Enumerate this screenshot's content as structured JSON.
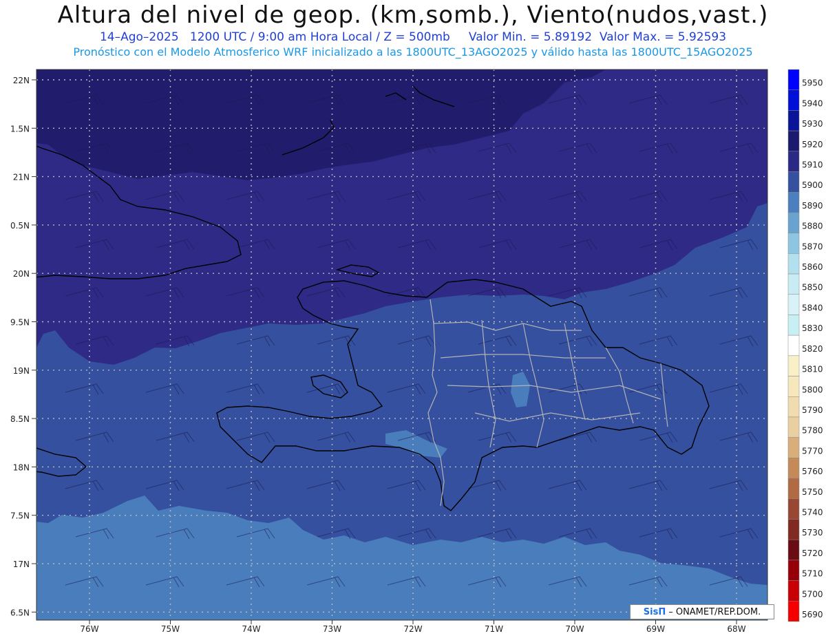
{
  "title": "Altura del nivel de geop. (km,somb.), Viento(nudos,vast.)",
  "subtitle_line1": {
    "date_time": "14–Ago–2025   1200 UTC / 9:00 am Hora Local / Z = 500mb",
    "min_label": "Valor Min. = 5.89192",
    "max_label": "Valor Max. = 5.92593"
  },
  "subtitle_line2": "Pronóstico con el Modelo Atmosferico WRF inicializado a las 1800UTC_13AGO2025 y válido hasta las  1800UTC_15AGO2025",
  "credit": {
    "logo": "SisΠ",
    "text": "– ONAMET/REP.DOM."
  },
  "map_data": {
    "lat_labels": [
      "22N",
      "1.5N",
      "21N",
      "0.5N",
      "20N",
      "9.5N",
      "19N",
      "8.5N",
      "18N",
      "7.5N",
      "17N",
      "6.5N"
    ],
    "lon_labels": [
      "76W",
      "75W",
      "74W",
      "73W",
      "72W",
      "71W",
      "70W",
      "69W",
      "68W"
    ],
    "colorbar": [
      {
        "value": "5950",
        "color": "#0000ff"
      },
      {
        "value": "5940",
        "color": "#0010d8"
      },
      {
        "value": "5930",
        "color": "#0a1498"
      },
      {
        "value": "5920",
        "color": "#1c1a6e"
      },
      {
        "value": "5910",
        "color": "#2a2a86"
      },
      {
        "value": "5900",
        "color": "#34509e"
      },
      {
        "value": "5890",
        "color": "#4b7fbd"
      },
      {
        "value": "5880",
        "color": "#6aa2d0"
      },
      {
        "value": "5870",
        "color": "#8ec6e2"
      },
      {
        "value": "5860",
        "color": "#b2e0ee"
      },
      {
        "value": "5850",
        "color": "#c8ecf4"
      },
      {
        "value": "5840",
        "color": "#d8f2f8"
      },
      {
        "value": "5830",
        "color": "#c8f0f4"
      },
      {
        "value": "5820",
        "color": "#ffffff"
      },
      {
        "value": "5810",
        "color": "#faf0c8"
      },
      {
        "value": "5800",
        "color": "#f6e8bc"
      },
      {
        "value": "5790",
        "color": "#f0dcae"
      },
      {
        "value": "5780",
        "color": "#ead0a0"
      },
      {
        "value": "5770",
        "color": "#d8ae7a"
      },
      {
        "value": "5760",
        "color": "#c48a5a"
      },
      {
        "value": "5750",
        "color": "#b06a44"
      },
      {
        "value": "5740",
        "color": "#984832"
      },
      {
        "value": "5730",
        "color": "#802a22"
      },
      {
        "value": "5720",
        "color": "#6a0c14"
      },
      {
        "value": "5710",
        "color": "#960008"
      },
      {
        "value": "5700",
        "color": "#c80006"
      },
      {
        "value": "5690",
        "color": "#f40000"
      }
    ],
    "shading": {
      "north_dark": "#221c6c",
      "band_5910": "#2e2a86",
      "band_5900": "#34509e",
      "band_5890": "#4a7dbc",
      "gridline": "#bcbcbc",
      "coast": "#000000",
      "provinces": "#b4b4b4"
    }
  }
}
